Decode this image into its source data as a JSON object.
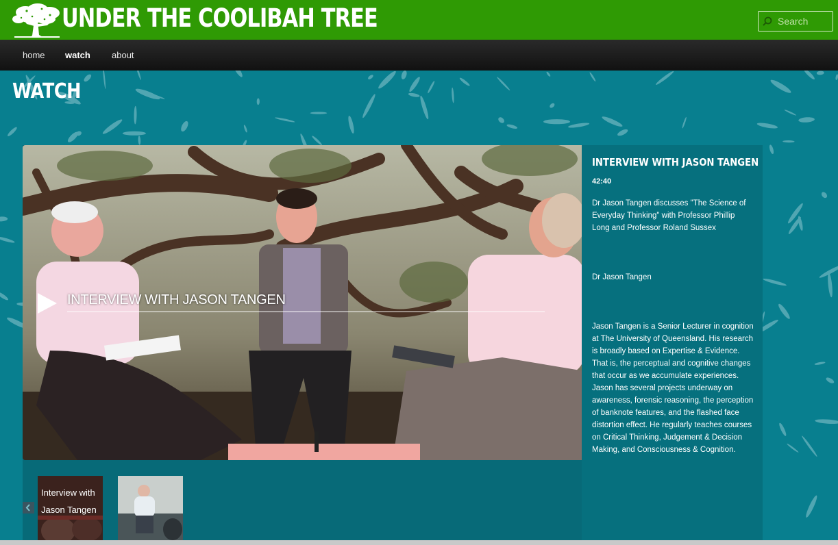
{
  "site": {
    "title": "UNDER THE COOLIBAH TREE",
    "logo_icon": "tree-icon"
  },
  "search": {
    "placeholder": "Search",
    "icon": "search-icon"
  },
  "nav": {
    "items": [
      {
        "label": "home",
        "active": false
      },
      {
        "label": "watch",
        "active": true
      },
      {
        "label": "about",
        "active": false
      }
    ]
  },
  "page": {
    "heading": "WATCH"
  },
  "video": {
    "overlay_title": "INTERVIEW WITH JASON TANGEN",
    "play_icon": "play-icon"
  },
  "info": {
    "title": "INTERVIEW WITH JASON TANGEN",
    "duration": "42:40",
    "summary": "Dr Jason Tangen discusses \"The Science of Everyday Thinking\" with Professor Phillip Long and Professor Roland Sussex",
    "speaker": "Dr Jason Tangen",
    "bio": "Jason Tangen is a Senior Lecturer in cognition at The University of Queensland. His research is broadly based on Expertise & Evidence. That is, the perceptual and cognitive changes that occur as we accumulate experiences. Jason has several projects underway on awareness, forensic reasoning, the perception of banknote features, and the flashed face distortion effect. He regularly teaches courses on Critical Thinking, Judgement & Decision Making, and Consciousness & Cognition."
  },
  "thumbnails": [
    {
      "label": "Interview with Jason Tangen"
    },
    {
      "label": ""
    }
  ],
  "colors": {
    "header_green": "#2f9a04",
    "teal_background": "#087f8f",
    "panel_teal": "#076a78",
    "nav_black": "#1b1b1b"
  }
}
